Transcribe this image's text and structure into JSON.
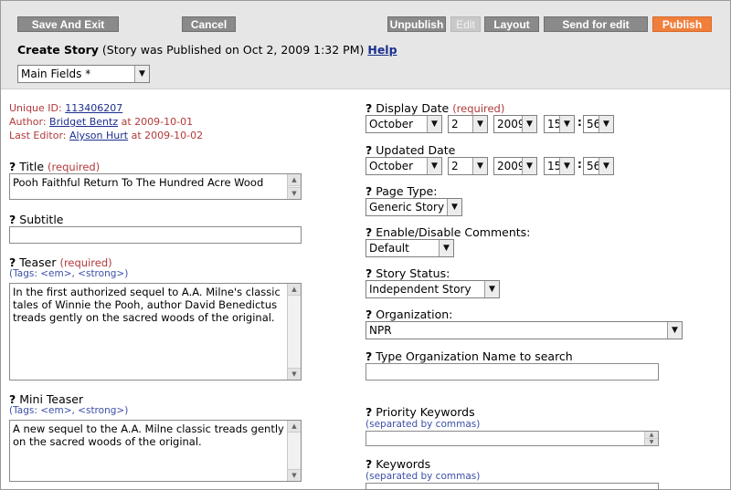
{
  "toolbar": {
    "save_exit": "Save And Exit",
    "cancel": "Cancel",
    "unpublish": "Unpublish",
    "edit": "Edit",
    "layout": "Layout",
    "send_for_edit": "Send for edit",
    "publish": "Publish"
  },
  "header": {
    "title": "Create Story",
    "status": "(Story was Published on Oct 2, 2009 1:32 PM)",
    "help": "Help",
    "section_select": "Main Fields *"
  },
  "meta": {
    "unique_id_label": "Unique ID:",
    "unique_id": "113406207",
    "author_label": "Author:",
    "author": "Bridget Bentz",
    "author_date": "at 2009-10-01",
    "editor_label": "Last Editor:",
    "editor": "Alyson Hurt",
    "editor_date": "at 2009-10-02"
  },
  "left": {
    "title_label": "Title",
    "required": "(required)",
    "title_value": "Pooh Faithful Return To The Hundred Acre Wood",
    "subtitle_label": "Subtitle",
    "subtitle_value": "",
    "teaser_label": "Teaser",
    "tags_hint": "(Tags: <em>, <strong>)",
    "teaser_value": "In the first authorized sequel to A.A. Milne's classic tales of Winnie the Pooh, author David Benedictus treads gently on the sacred woods of the original.",
    "mini_teaser_label": "Mini Teaser",
    "mini_teaser_value": "A new sequel to the A.A. Milne classic treads gently on the sacred woods of the original."
  },
  "right": {
    "display_date_label": "Display Date",
    "display_date": {
      "month": "October",
      "day": "2",
      "year": "2009",
      "hour": "15",
      "minute": "56"
    },
    "updated_date_label": "Updated Date",
    "updated_date": {
      "month": "October",
      "day": "2",
      "year": "2009",
      "hour": "15",
      "minute": "56"
    },
    "time_sep": ":",
    "page_type_label": "Page Type:",
    "page_type": "Generic Story",
    "comments_label": "Enable/Disable Comments:",
    "comments": "Default",
    "story_status_label": "Story Status:",
    "story_status": "Independent Story",
    "organization_label": "Organization:",
    "organization": "NPR",
    "org_search_label": "Type Organization Name to search",
    "org_search_value": "",
    "priority_keywords_label": "Priority Keywords",
    "separated_hint": "(separated by commas)",
    "keywords_label": "Keywords"
  },
  "icons": {
    "question": "?",
    "dropdown": "▼",
    "scroll_up": "▲",
    "scroll_down": "▼"
  },
  "colors": {
    "publish": "#f07f3c",
    "required": "#b2393b",
    "link": "#1c2f8f",
    "hint": "#3b4fa8"
  }
}
